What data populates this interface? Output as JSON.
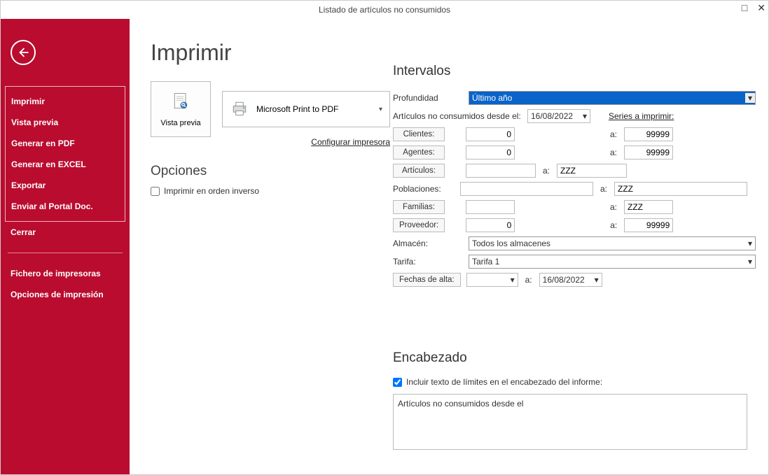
{
  "window": {
    "title": "Listado de artículos no consumidos"
  },
  "sidebar": {
    "items": [
      "Imprimir",
      "Vista previa",
      "Generar en PDF",
      "Generar en EXCEL",
      "Exportar",
      "Enviar al Portal Doc."
    ],
    "close": "Cerrar",
    "bottom": [
      "Fichero de impresoras",
      "Opciones de impresión"
    ]
  },
  "page_heading": "Imprimir",
  "preview_btn": "Vista previa",
  "printer": {
    "name": "Microsoft Print to PDF",
    "config_link": "Configurar impresora"
  },
  "options": {
    "heading": "Opciones",
    "reverse": "Imprimir en orden inverso"
  },
  "intervals": {
    "heading": "Intervalos",
    "depth_label": "Profundidad",
    "depth_value": "Último año",
    "since_label": "Artículos no consumidos desde el:",
    "since_date": "16/08/2022",
    "series_link": "Series a imprimir:",
    "a_label": "a:",
    "clientes": {
      "label": "Clientes:",
      "from": "0",
      "to": "99999"
    },
    "agentes": {
      "label": "Agentes:",
      "from": "0",
      "to": "99999"
    },
    "articulos": {
      "label": "Artículos:",
      "from": "",
      "to": "ZZZ"
    },
    "poblaciones": {
      "label": "Poblaciones:",
      "from": "",
      "to": "ZZZ"
    },
    "familias": {
      "label": "Familias:",
      "from": "",
      "to": "ZZZ"
    },
    "proveedor": {
      "label": "Proveedor:",
      "from": "0",
      "to": "99999"
    },
    "almacen": {
      "label": "Almacén:",
      "value": "Todos los almacenes"
    },
    "tarifa": {
      "label": "Tarifa:",
      "value": "Tarifa 1"
    },
    "fechas_alta": {
      "label": "Fechas de alta:",
      "from": "",
      "to": "16/08/2022"
    }
  },
  "encabezado": {
    "heading": "Encabezado",
    "check_label": "Incluir texto de límites en el encabezado del informe:",
    "text": "Artículos no consumidos desde el"
  }
}
